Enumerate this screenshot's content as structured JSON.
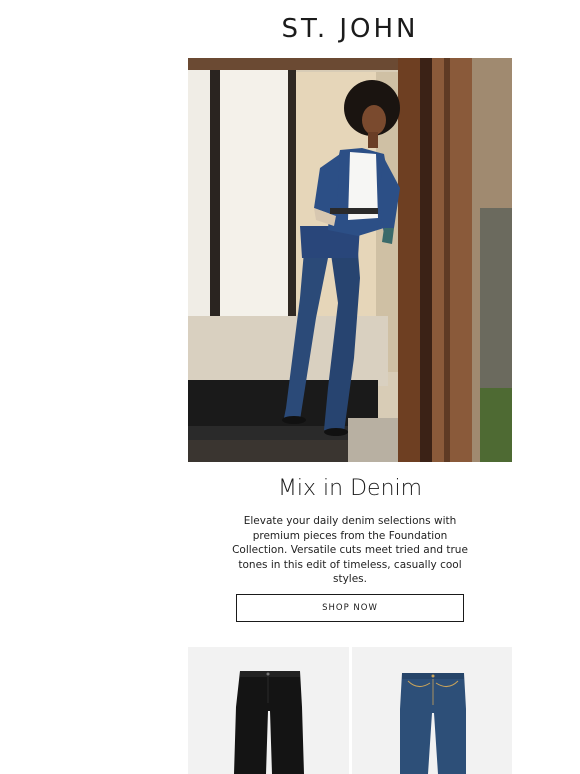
{
  "brand": {
    "logo_text": "ST. JOHN"
  },
  "hero": {
    "image_alt": "Model wearing denim jacket, white tee and wide-leg jeans leaning in a doorway"
  },
  "feature": {
    "headline": "Mix in Denim",
    "body": "Elevate your daily denim selections with premium pieces from the Foundation Collection. Versatile cuts meet tried and true tones in this edit of timeless, casually cool styles.",
    "cta_label": "SHOP NOW"
  },
  "products": [
    {
      "image_alt": "Black wide-leg jeans",
      "color": "#141414"
    },
    {
      "image_alt": "Medium blue wash jeans",
      "color": "#2d4f78"
    }
  ],
  "colors": {
    "text": "#1a1a1a",
    "background": "#ffffff",
    "tile_bg": "#f2f2f2"
  }
}
